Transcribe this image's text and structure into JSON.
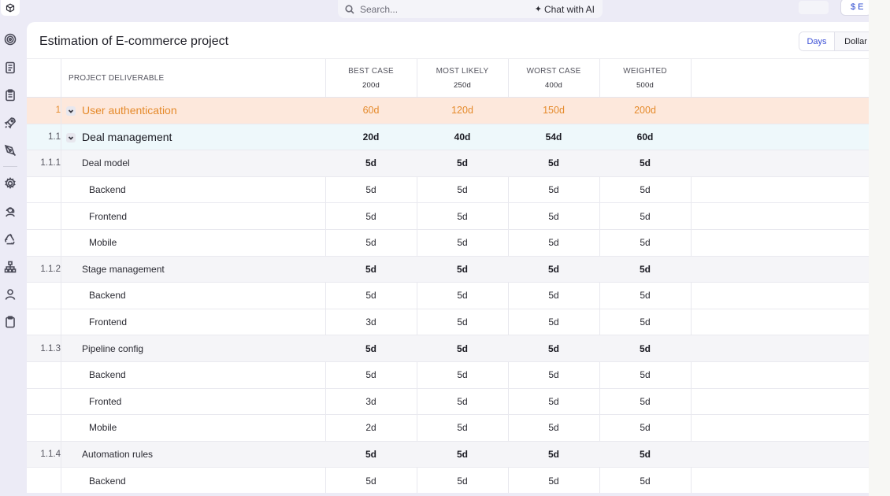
{
  "topbar": {
    "search_placeholder": "Search...",
    "chat_label": "Chat with AI",
    "right_button_label": "$ E"
  },
  "card": {
    "title": "Estimation of E-commerce project",
    "toggle": {
      "days": "Days",
      "dollar": "Dollar",
      "active": "Days"
    }
  },
  "table": {
    "header": {
      "deliverable": "PROJECT DELIVERABLE",
      "columns": [
        {
          "label": "BEST CASE",
          "total": "200d"
        },
        {
          "label": "MOST LIKELY",
          "total": "250d"
        },
        {
          "label": "WORST CASE",
          "total": "400d"
        },
        {
          "label": "WEIGHTED",
          "total": "500d"
        }
      ]
    },
    "rows": [
      {
        "level": 1,
        "num": "1",
        "name": "User authentication",
        "values": [
          "60d",
          "120d",
          "150d",
          "200d"
        ]
      },
      {
        "level": 2,
        "num": "1.1",
        "name": "Deal management",
        "values": [
          "20d",
          "40d",
          "54d",
          "60d"
        ]
      },
      {
        "level": 3,
        "num": "1.1.1",
        "name": "Deal model",
        "values": [
          "5d",
          "5d",
          "5d",
          "5d"
        ]
      },
      {
        "level": 4,
        "num": "",
        "name": "Backend",
        "values": [
          "5d",
          "5d",
          "5d",
          "5d"
        ]
      },
      {
        "level": 4,
        "num": "",
        "name": "Frontend",
        "values": [
          "5d",
          "5d",
          "5d",
          "5d"
        ]
      },
      {
        "level": 4,
        "num": "",
        "name": "Mobile",
        "values": [
          "5d",
          "5d",
          "5d",
          "5d"
        ]
      },
      {
        "level": 3,
        "num": "1.1.2",
        "name": "Stage management",
        "values": [
          "5d",
          "5d",
          "5d",
          "5d"
        ]
      },
      {
        "level": 4,
        "num": "",
        "name": "Backend",
        "values": [
          "5d",
          "5d",
          "5d",
          "5d"
        ]
      },
      {
        "level": 4,
        "num": "",
        "name": "Frontend",
        "values": [
          "3d",
          "5d",
          "5d",
          "5d"
        ]
      },
      {
        "level": 3,
        "num": "1.1.3",
        "name": "Pipeline config",
        "values": [
          "5d",
          "5d",
          "5d",
          "5d"
        ]
      },
      {
        "level": 4,
        "num": "",
        "name": "Backend",
        "values": [
          "5d",
          "5d",
          "5d",
          "5d"
        ]
      },
      {
        "level": 4,
        "num": "",
        "name": "Fronted",
        "values": [
          "3d",
          "5d",
          "5d",
          "5d"
        ]
      },
      {
        "level": 4,
        "num": "",
        "name": "Mobile",
        "values": [
          "2d",
          "5d",
          "5d",
          "5d"
        ]
      },
      {
        "level": 3,
        "num": "1.1.4",
        "name": "Automation rules",
        "values": [
          "5d",
          "5d",
          "5d",
          "5d"
        ]
      },
      {
        "level": 4,
        "num": "",
        "name": "Backend",
        "values": [
          "5d",
          "5d",
          "5d",
          "5d"
        ]
      }
    ]
  },
  "sidebar": {
    "icons": [
      "logo-cube-icon",
      "target-icon",
      "document-icon",
      "clipboard-icon",
      "rocket-icon",
      "pen-tool-icon",
      "settings-gear-icon",
      "support-agent-icon",
      "recycle-icon",
      "org-chart-icon",
      "user-icon",
      "clipboard-blank-icon"
    ]
  }
}
